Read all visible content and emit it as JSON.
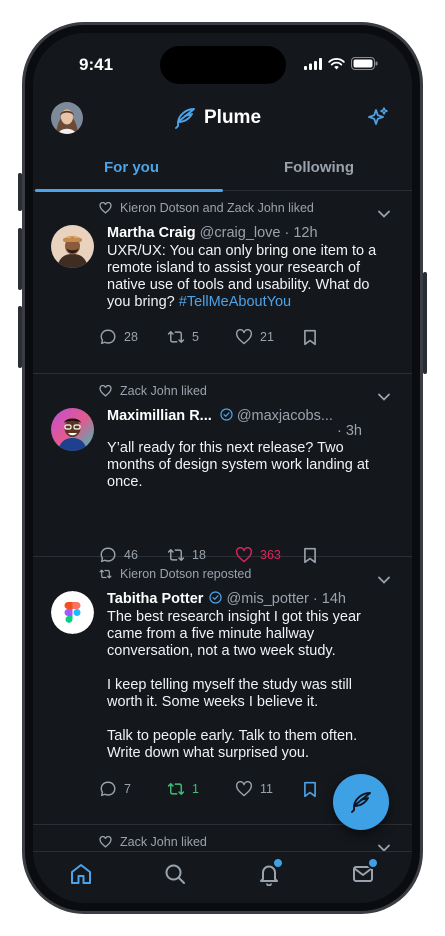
{
  "status": {
    "time": "9:41"
  },
  "app": {
    "title": "Plume"
  },
  "tabs": [
    {
      "label": "For you",
      "selected": true
    },
    {
      "label": "Following",
      "selected": false
    }
  ],
  "posts": [
    {
      "context_type": "liked",
      "context": "Kieron Dotson and Zack John liked",
      "name": "Martha Craig",
      "verified": false,
      "handle": "@craig_love",
      "time": "· 12h",
      "text_main": "UXR/UX: You can only bring one item to a remote island to assist your research of native use of tools and usability. What do you bring? ",
      "hashtag": "#TellMeAboutYou",
      "replies": "28",
      "reposts": "5",
      "likes": "21",
      "liked": false,
      "reposted": false,
      "bookmarked": false
    },
    {
      "context_type": "liked",
      "context": "Zack John liked",
      "name": "Maximillian R...",
      "verified": true,
      "handle": "@maxjacobs...",
      "time": "· 3h",
      "text_main": "Y’all ready for this next release? Two months of design system work landing at once.",
      "replies": "46",
      "reposts": "18",
      "likes": "363",
      "liked": true,
      "reposted": false,
      "bookmarked": false
    },
    {
      "context_type": "reposted",
      "context": "Kieron Dotson reposted",
      "name": "Tabitha Potter",
      "verified": true,
      "handle": "@mis_potter",
      "time": "· 14h",
      "paragraphs": [
        "The best research insight I got this year came from a five minute hallway conversation, not a two week study.",
        "I keep telling myself the study was still worth it. Some weeks I believe it.",
        "Talk to people early. Talk to them often. Write down what surprised you."
      ],
      "replies": "7",
      "reposts": "1",
      "likes": "11",
      "liked": false,
      "reposted": true,
      "bookmarked": true
    },
    {
      "context_type": "liked",
      "context": "Zack John liked"
    }
  ],
  "colors": {
    "accent": "#4da3e8",
    "like": "#e0245e",
    "repost": "#3fbf7a",
    "background": "#14171c"
  },
  "icons": {
    "header": [
      "avatar",
      "feather-icon",
      "sparkle-icon"
    ],
    "actions": [
      "reply-icon",
      "repost-icon",
      "heart-icon",
      "bookmark-icon"
    ],
    "tabbar": [
      "home-icon",
      "search-icon",
      "bell-icon",
      "mail-icon"
    ],
    "fab": "feather-icon"
  },
  "notifications": {
    "bell_badge": true,
    "mail_badge": true
  }
}
